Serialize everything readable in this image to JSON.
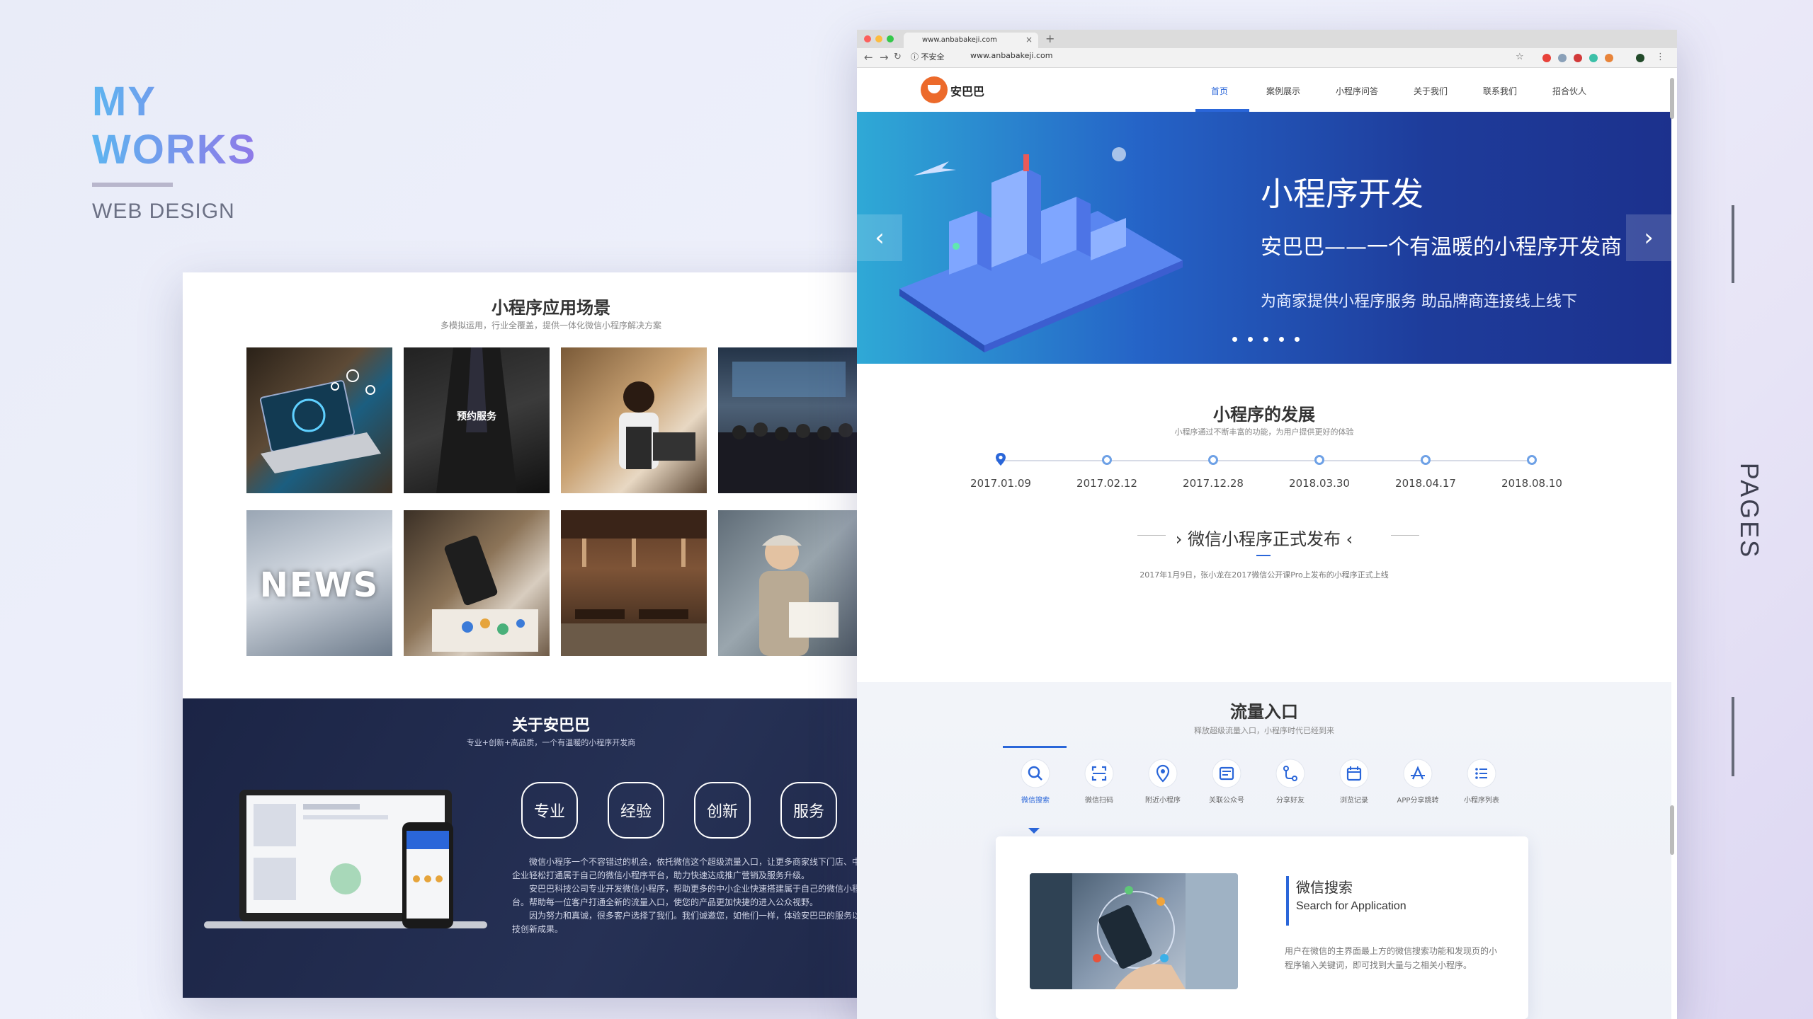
{
  "header": {
    "title_line1": "MY",
    "title_line2": "WORKS",
    "subtitle": "WEB DESIGN"
  },
  "side_label": "PAGES",
  "left_card": {
    "title": "小程序应用场景",
    "subtitle": "多模拟运用，行业全覆盖，提供一体化微信小程序解决方案",
    "tiles": [
      {
        "label": ""
      },
      {
        "label": "预约服务"
      },
      {
        "label": ""
      },
      {
        "label": ""
      },
      {
        "label": "NEWS"
      },
      {
        "label": ""
      },
      {
        "label": ""
      },
      {
        "label": ""
      }
    ],
    "about": {
      "title": "关于安巴巴",
      "subtitle": "专业+创新+高品质，一个有温暖的小程序开发商",
      "values": [
        "专业",
        "经验",
        "创新",
        "服务"
      ],
      "paragraphs": [
        "微信小程序一个不容错过的机会，依托微信这个超级流量入口，让更多商家线下门店、中小型企业轻松打通属于自己的微信小程序平台，助力快速达成推广营销及服务升级。",
        "安巴巴科技公司专业开发微信小程序，帮助更多的中小企业快速搭建属于自己的微信小程序平台。帮助每一位客户打通全新的流量入口，使您的产品更加快捷的进入公众视野。",
        "因为努力和真诚，很多客户选择了我们。我们诚邀您，如他们一样，体验安巴巴的服务以及科技创新成果。"
      ]
    }
  },
  "browser": {
    "tab_title": "www.anbabakeji.com",
    "url_security": "不安全",
    "url": "www.anbabakeji.com",
    "logo_text": "安巴巴",
    "nav": [
      "首页",
      "案例展示",
      "小程序问答",
      "关于我们",
      "联系我们",
      "招合伙人"
    ],
    "banner": {
      "heading": "小程序开发",
      "tagline": "安巴巴——一个有温暖的小程序开发商",
      "description": "为商家提供小程序服务  助品牌商连接线上线下",
      "prev_icon": "chevron-left-icon",
      "next_icon": "chevron-right-icon"
    },
    "development": {
      "title": "小程序的发展",
      "subtitle": "小程序通过不断丰富的功能，为用户提供更好的体验",
      "dates": [
        "2017.01.09",
        "2017.02.12",
        "2017.12.28",
        "2018.03.30",
        "2018.04.17",
        "2018.08.10"
      ],
      "release_title": "微信小程序正式发布",
      "release_desc": "2017年1月9日，张小龙在2017微信公开课Pro上发布的小程序正式上线"
    },
    "traffic": {
      "title": "流量入口",
      "subtitle": "释放超级流量入口，小程序时代已经到来",
      "tabs": [
        {
          "label": "微信搜索",
          "icon": "search-icon"
        },
        {
          "label": "微信扫码",
          "icon": "scan-icon"
        },
        {
          "label": "附近小程序",
          "icon": "location-icon"
        },
        {
          "label": "关联公众号",
          "icon": "article-icon"
        },
        {
          "label": "分享好友",
          "icon": "share-icon"
        },
        {
          "label": "浏览记录",
          "icon": "calendar-icon"
        },
        {
          "label": "APP分享跳转",
          "icon": "app-store-icon"
        },
        {
          "label": "小程序列表",
          "icon": "list-icon"
        }
      ],
      "card": {
        "title": "微信搜索",
        "subtitle_en": "Search for Application",
        "description": "用户在微信的主界面最上方的微信搜索功能和发现页的小程序输入关键词，即可找到大量与之相关小程序。"
      }
    }
  },
  "colors": {
    "accent": "#2a66d9",
    "title_gradient_start": "#5db5f0",
    "title_gradient_end": "#8f79e8",
    "dark_section": "#1f2849"
  }
}
